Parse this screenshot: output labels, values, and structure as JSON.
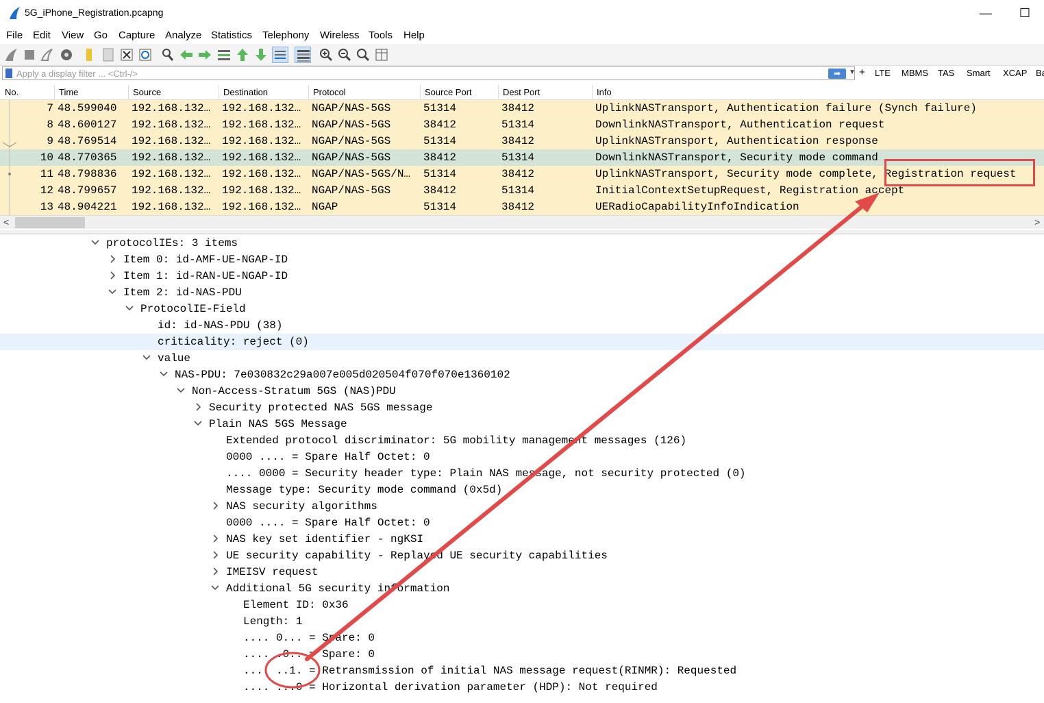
{
  "window": {
    "title": "5G_iPhone_Registration.pcapng",
    "minimize": "—",
    "maximize": "☐"
  },
  "menu": [
    "File",
    "Edit",
    "View",
    "Go",
    "Capture",
    "Analyze",
    "Statistics",
    "Telephony",
    "Wireless",
    "Tools",
    "Help"
  ],
  "toolbar_icons": [
    "shark-fin-start-icon",
    "stop-capture-icon",
    "restart-capture-icon",
    "capture-options-icon",
    "open-file-icon",
    "save-file-icon",
    "close-file-icon",
    "reload-file-icon",
    "find-packet-icon",
    "go-back-icon",
    "go-forward-icon",
    "go-to-packet-icon",
    "first-packet-icon",
    "last-packet-icon",
    "autoscroll-icon",
    "colorize-icon",
    "zoom-in-icon",
    "zoom-out-icon",
    "normal-size-icon",
    "resize-columns-icon"
  ],
  "filter": {
    "placeholder": "Apply a display filter ... <Ctrl-/>",
    "apply": "➡",
    "buttons": [
      "LTE",
      "MBMS",
      "TAS",
      "Smart",
      "XCAP",
      "Ba"
    ]
  },
  "columns": [
    "No.",
    "Time",
    "Source",
    "Destination",
    "Protocol",
    "Source Port",
    "Dest Port",
    "Info"
  ],
  "packets": [
    {
      "no": "7",
      "time": "48.599040",
      "src": "192.168.132…",
      "dst": "192.168.132…",
      "proto": "NGAP/NAS-5GS",
      "sport": "51314",
      "dport": "38412",
      "info": "UplinkNASTransport, Authentication failure (Synch failure)"
    },
    {
      "no": "8",
      "time": "48.600127",
      "src": "192.168.132…",
      "dst": "192.168.132…",
      "proto": "NGAP/NAS-5GS",
      "sport": "38412",
      "dport": "51314",
      "info": "DownlinkNASTransport, Authentication request"
    },
    {
      "no": "9",
      "time": "48.769514",
      "src": "192.168.132…",
      "dst": "192.168.132…",
      "proto": "NGAP/NAS-5GS",
      "sport": "51314",
      "dport": "38412",
      "info": "UplinkNASTransport, Authentication response"
    },
    {
      "no": "10",
      "time": "48.770365",
      "src": "192.168.132…",
      "dst": "192.168.132…",
      "proto": "NGAP/NAS-5GS",
      "sport": "38412",
      "dport": "51314",
      "info": "DownlinkNASTransport, Security mode command"
    },
    {
      "no": "11",
      "time": "48.798836",
      "src": "192.168.132…",
      "dst": "192.168.132…",
      "proto": "NGAP/NAS-5GS/N…",
      "sport": "51314",
      "dport": "38412",
      "info": "UplinkNASTransport, Security mode complete, Registration request"
    },
    {
      "no": "12",
      "time": "48.799657",
      "src": "192.168.132…",
      "dst": "192.168.132…",
      "proto": "NGAP/NAS-5GS",
      "sport": "38412",
      "dport": "51314",
      "info": "InitialContextSetupRequest, Registration accept"
    },
    {
      "no": "13",
      "time": "48.904221",
      "src": "192.168.132…",
      "dst": "192.168.132…",
      "proto": "NGAP",
      "sport": "51314",
      "dport": "38412",
      "info": "UERadioCapabilityInfoIndication"
    }
  ],
  "scroll": {
    "left": "<",
    "right": ">"
  },
  "tree": [
    "protocolIEs: 3 items",
    "Item 0: id-AMF-UE-NGAP-ID",
    "Item 1: id-RAN-UE-NGAP-ID",
    "Item 2: id-NAS-PDU",
    "ProtocolIE-Field",
    "id: id-NAS-PDU (38)",
    "criticality: reject (0)",
    "value",
    "NAS-PDU: 7e030832c29a007e005d020504f070f070e1360102",
    "Non-Access-Stratum 5GS (NAS)PDU",
    "Security protected NAS 5GS message",
    "Plain NAS 5GS Message",
    "Extended protocol discriminator: 5G mobility management messages (126)",
    "0000 .... = Spare Half Octet: 0",
    ".... 0000 = Security header type: Plain NAS message, not security protected (0)",
    "Message type: Security mode command (0x5d)",
    "NAS security algorithms",
    "0000 .... = Spare Half Octet: 0",
    "NAS key set identifier - ngKSI",
    "UE security capability - Replayed UE security capabilities",
    "IMEISV request",
    "Additional 5G security information",
    "Element ID: 0x36",
    "Length: 1",
    ".... 0... = Spare: 0",
    ".... .0.. = Spare: 0",
    ".... ..1. = Retransmission of initial NAS message request(RINMR): Requested",
    ".... ...0 = Horizontal derivation parameter (HDP): Not required"
  ]
}
